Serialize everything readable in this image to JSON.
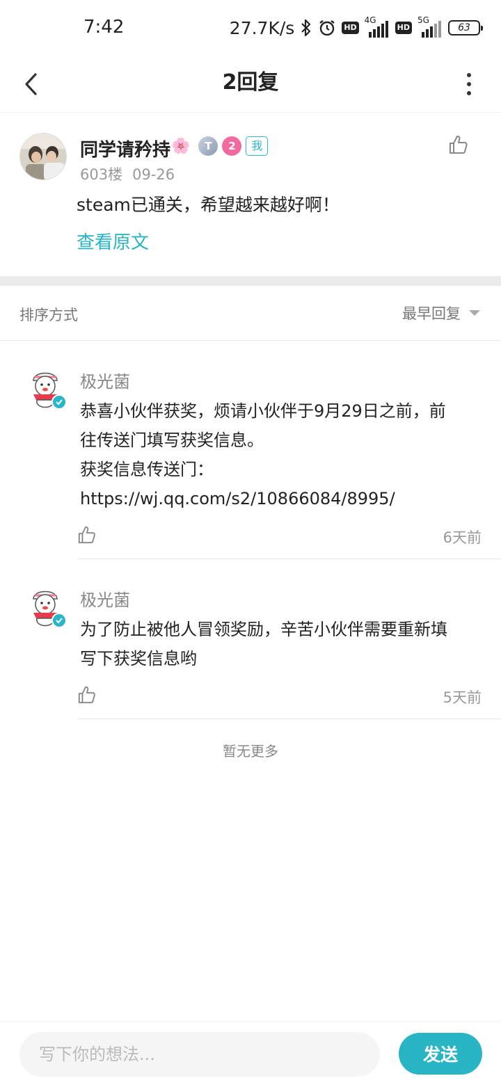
{
  "status_bar": {
    "time": "7:42",
    "net_speed": "27.7K/s",
    "icons": [
      "bluetooth-icon",
      "alarm-icon",
      "hd-icon",
      "signal-4g-icon",
      "hd-icon",
      "signal-5g-icon",
      "battery-icon"
    ],
    "hd_label": "HD",
    "sig1_label": "4G",
    "sig2_label": "5G",
    "battery": "63"
  },
  "nav": {
    "title": "2回复",
    "back_icon": "chevron-left-icon",
    "more_icon": "more-vertical-icon"
  },
  "post": {
    "username": "同学请矜持",
    "username_emoji": "🌸",
    "badge_t": "T",
    "badge_level": "2",
    "me_tag": "我",
    "floor": "603楼",
    "date": "09-26",
    "content": "steam已通关，希望越来越好啊！",
    "view_original": "查看原文"
  },
  "sort": {
    "label": "排序方式",
    "value": "最早回复"
  },
  "replies": [
    {
      "name": "极光菌",
      "lines": [
        "恭喜小伙伴获奖，烦请小伙伴于9月29日之前，前",
        "往传送门填写获奖信息。",
        "获奖信息传送门：",
        "https://wj.qq.com/s2/10866084/8995/"
      ],
      "time": "6天前"
    },
    {
      "name": "极光菌",
      "lines": [
        "为了防止被他人冒领奖励，辛苦小伙伴需要重新填",
        "写下获奖信息哟"
      ],
      "time": "5天前"
    }
  ],
  "no_more": "暂无更多",
  "bottom": {
    "placeholder": "写下你的想法...",
    "send_label": "发送"
  },
  "colors": {
    "accent": "#29b5c4",
    "level_badge": "#f36aa0",
    "divider": "#ebebeb"
  }
}
